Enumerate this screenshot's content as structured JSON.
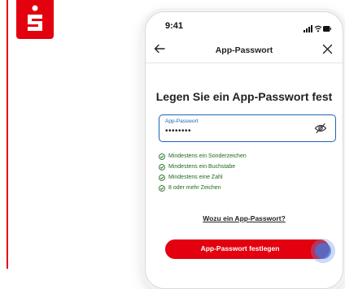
{
  "brand": {
    "logo_icon": "sparkasse-logo-icon",
    "accent": "#e3000f"
  },
  "status_bar": {
    "time": "9:41",
    "icons": [
      "signal-icon",
      "wifi-icon",
      "battery-icon"
    ]
  },
  "nav": {
    "back_icon": "arrow-left-icon",
    "title": "App-Passwort",
    "close_icon": "close-icon"
  },
  "heading": "Legen Sie ein App-Passwort fest",
  "password_field": {
    "label": "App-Passwort",
    "value": "••••••••",
    "toggle_icon": "eye-off-icon",
    "accent": "#1a63b8"
  },
  "requirements": [
    {
      "text": "Mindestens ein Sonderzeichen",
      "met": true
    },
    {
      "text": "Mindestens ein Buchstabe",
      "met": true
    },
    {
      "text": "Mindestens eine Zahl",
      "met": true
    },
    {
      "text": "8 oder mehr Zeichen",
      "met": true
    }
  ],
  "help_link": "Wozu ein App-Passwort?",
  "cta": {
    "label": "App-Passwort festlegen",
    "color": "#e3000f"
  }
}
